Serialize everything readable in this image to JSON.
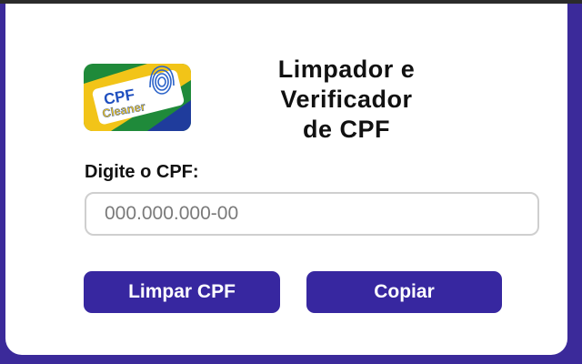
{
  "colors": {
    "accent": "#3727a0",
    "frame": "#3b2a9a",
    "logo_green": "#1f8a3a",
    "logo_yellow": "#f2c418",
    "logo_blue": "#1f3c9c"
  },
  "logo": {
    "line1": "CPF",
    "line2": "Cleaner",
    "icon": "fingerprint-icon"
  },
  "header": {
    "title_line1": "Limpador e",
    "title_line2": "Verificador",
    "title_line3": "de CPF"
  },
  "form": {
    "label": "Digite o CPF:",
    "input_placeholder": "000.000.000-00",
    "input_value": ""
  },
  "actions": {
    "clean_label": "Limpar CPF",
    "copy_label": "Copiar"
  }
}
